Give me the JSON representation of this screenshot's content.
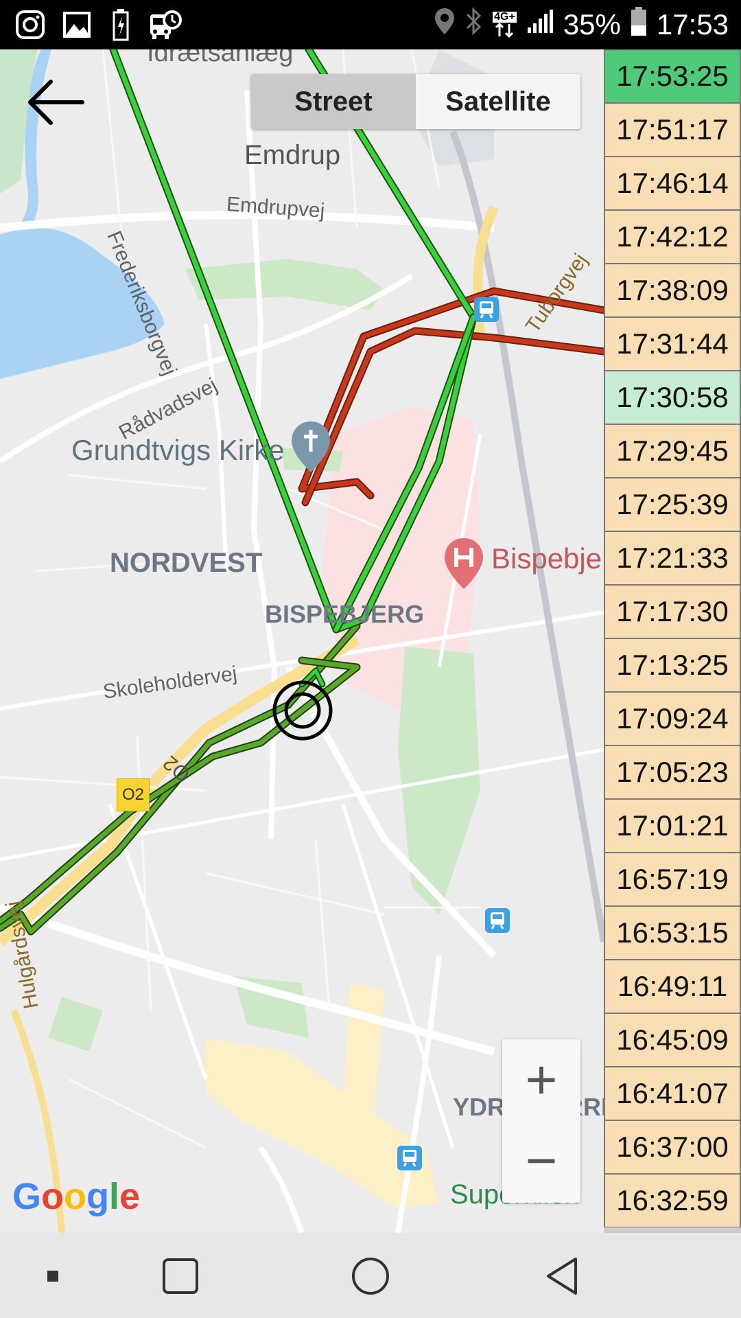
{
  "status_bar": {
    "battery_percent": "35%",
    "clock": "17:53",
    "network": "4G+",
    "left_icons": [
      "instagram-icon",
      "gallery-icon",
      "battery-saver-icon",
      "bus-tracker-icon"
    ],
    "right_icons": [
      "location-icon",
      "bluetooth-icon",
      "network-icon",
      "signal-icon",
      "battery-icon"
    ]
  },
  "map": {
    "type_toggle": {
      "street": "Street",
      "satellite": "Satellite",
      "selected": "Street"
    },
    "labels": {
      "idraetsanlaeg": "Idrætsanlæg",
      "emdrup": "Emdrup",
      "emdrupvej": "Emdrupvej",
      "frederiksborgvej": "Frederiksborgvej",
      "tuborgvej": "Tuborgvej",
      "radvadsvej": "Rådvadsvej",
      "grundtvigs_kirke": "Grundtvigs Kirke",
      "nordvest": "NORDVEST",
      "bispebjerg_area": "BISPEBJERG",
      "bispebjerg_hospital": "Bispebjer",
      "skoleholdervej": "Skoleholdervej",
      "o2_road": "O2",
      "o2_badge": "O2",
      "hulgardsvej": "Hulgårdsvej",
      "ydre_norrebro": "YDRE NORRE",
      "superkilen": "Superkilen"
    },
    "zoom": {
      "in": "+",
      "out": "−"
    },
    "attribution": "Google",
    "colors": {
      "recent_track": "#39d13b",
      "older_track": "#c8381b",
      "dark_track": "#3f8f1f"
    }
  },
  "time_list": {
    "items": [
      {
        "time": "17:53:25",
        "state": "current"
      },
      {
        "time": "17:51:17",
        "state": "normal"
      },
      {
        "time": "17:46:14",
        "state": "normal"
      },
      {
        "time": "17:42:12",
        "state": "normal"
      },
      {
        "time": "17:38:09",
        "state": "normal"
      },
      {
        "time": "17:31:44",
        "state": "normal"
      },
      {
        "time": "17:30:58",
        "state": "selected"
      },
      {
        "time": "17:29:45",
        "state": "normal"
      },
      {
        "time": "17:25:39",
        "state": "normal"
      },
      {
        "time": "17:21:33",
        "state": "normal"
      },
      {
        "time": "17:17:30",
        "state": "normal"
      },
      {
        "time": "17:13:25",
        "state": "normal"
      },
      {
        "time": "17:09:24",
        "state": "normal"
      },
      {
        "time": "17:05:23",
        "state": "normal"
      },
      {
        "time": "17:01:21",
        "state": "normal"
      },
      {
        "time": "16:57:19",
        "state": "normal"
      },
      {
        "time": "16:53:15",
        "state": "normal"
      },
      {
        "time": "16:49:11",
        "state": "normal"
      },
      {
        "time": "16:45:09",
        "state": "normal"
      },
      {
        "time": "16:41:07",
        "state": "normal"
      },
      {
        "time": "16:37:00",
        "state": "normal"
      },
      {
        "time": "16:32:59",
        "state": "normal"
      }
    ],
    "colors": {
      "current": "#4fc97a",
      "selected": "#c7ecd4",
      "normal": "#f8deb5"
    }
  },
  "nav_bar": {
    "buttons": [
      "recents-dot-icon",
      "overview-square-icon",
      "home-circle-icon",
      "back-triangle-icon"
    ]
  }
}
